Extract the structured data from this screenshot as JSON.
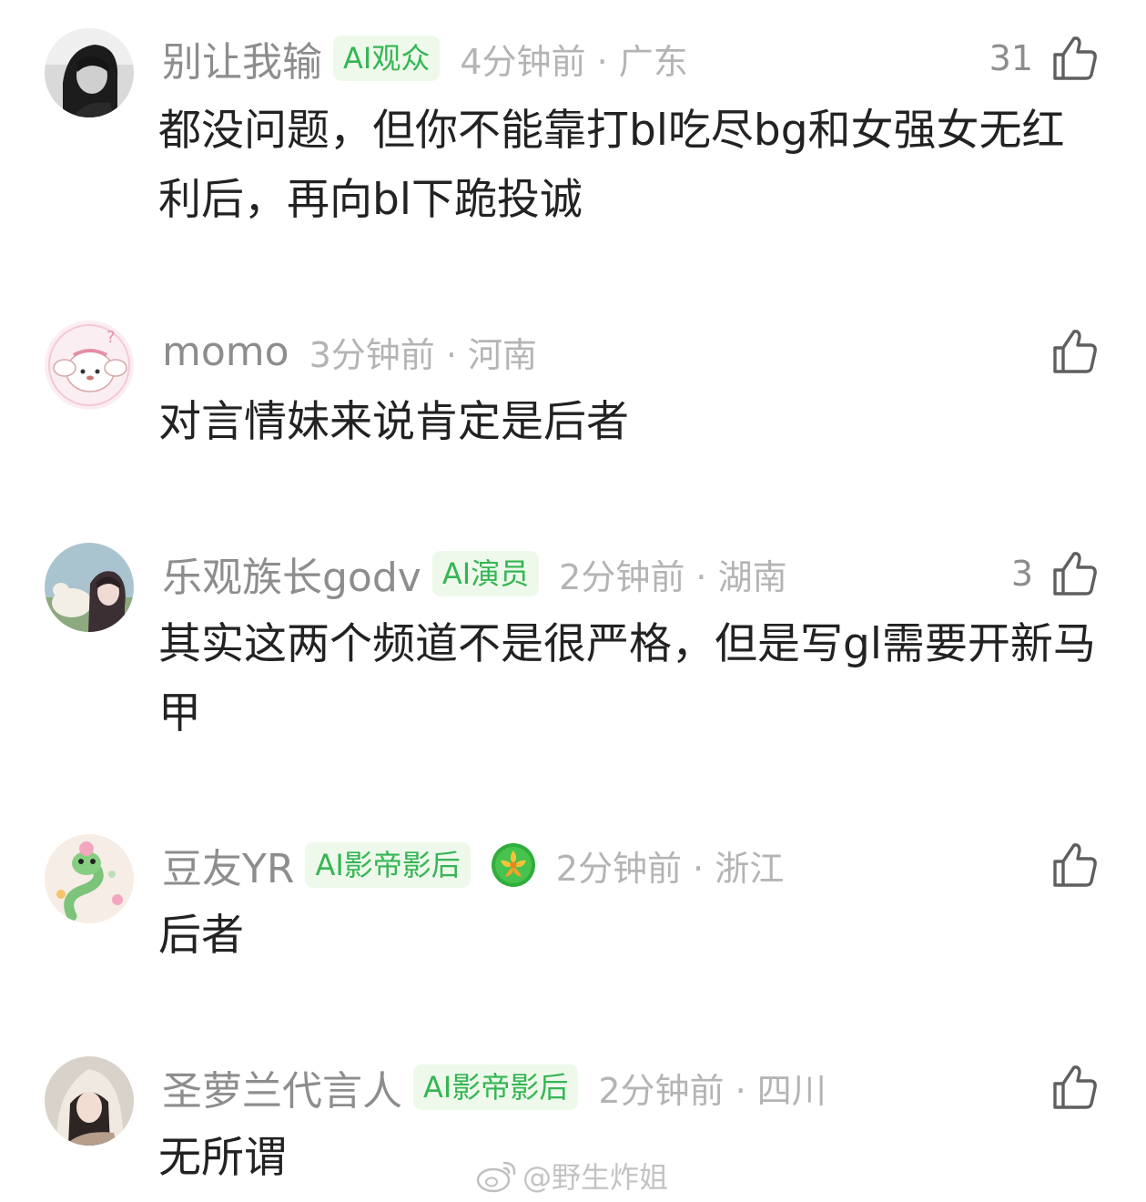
{
  "comments": [
    {
      "username": "别让我输",
      "badge": "AI观众",
      "meta": "4分钟前 · 广东",
      "likes": "31",
      "text": "都没问题，但你不能靠打bl吃尽bg和女强女无红利后，再向bl下跪投诚"
    },
    {
      "username": "momo",
      "badge": "",
      "meta": "3分钟前 · 河南",
      "likes": "",
      "text": "对言情妹来说肯定是后者"
    },
    {
      "username": "乐观族长godv",
      "badge": "AI演员",
      "meta": "2分钟前 · 湖南",
      "likes": "3",
      "text": "其实这两个频道不是很严格，但是写gl需要开新马甲"
    },
    {
      "username": "豆友YR",
      "badge": "AI影帝影后",
      "meta": "2分钟前 · 浙江",
      "likes": "",
      "text": "后者"
    },
    {
      "username": "圣萝兰代言人",
      "badge": "AI影帝影后",
      "meta": "2分钟前 · 四川",
      "likes": "",
      "text": "无所谓"
    }
  ],
  "watermark": "@野生炸姐",
  "colors": {
    "badge_bg": "#eef9ec",
    "badge_text": "#35b653",
    "username": "#8d8d8d",
    "meta": "#b4b4b4",
    "content": "#222222"
  },
  "icons": {
    "like": "thumbs-up-icon",
    "medal": "flower-medal-icon",
    "watermark": "weibo-logo-icon"
  }
}
